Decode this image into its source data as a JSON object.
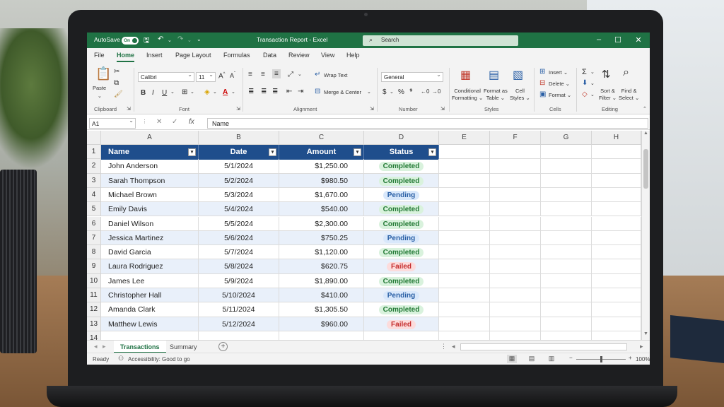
{
  "window": {
    "autosave_label": "AutoSave",
    "autosave_state": "On",
    "title": "Transaction Report - Excel",
    "search_placeholder": "Search"
  },
  "menu": [
    "File",
    "Home",
    "Insert",
    "Page Layout",
    "Formulas",
    "Data",
    "Review",
    "View",
    "Help"
  ],
  "ribbon": {
    "clipboard": {
      "paste": "Paste",
      "label": "Clipboard"
    },
    "font": {
      "name": "Calibri",
      "size": "11",
      "label": "Font"
    },
    "alignment": {
      "wrap_text": "Wrap Text",
      "merge_center": "Merge & Center",
      "label": "Alignment"
    },
    "number": {
      "format": "General",
      "label": "Number"
    },
    "styles": {
      "conditional": "Conditional",
      "formatting": "Formatting",
      "format_as": "Format as",
      "table": "Table",
      "cell": "Cell",
      "cell_styles": "Styles",
      "label": "Styles"
    },
    "cells": {
      "insert": "Insert",
      "delete": "Delete",
      "format": "Format",
      "label": "Cells"
    },
    "editing": {
      "sort": "Sort &",
      "filter": "Filter",
      "find": "Find &",
      "select": "Select",
      "label": "Editing"
    }
  },
  "formula_bar": {
    "cell_ref": "A1",
    "fx": "fx",
    "content": "Name"
  },
  "sheet": {
    "columns": [
      "A",
      "B",
      "C",
      "D",
      "E",
      "F",
      "G",
      "H"
    ],
    "headers": [
      "Name",
      "Date",
      "Amount",
      "Status"
    ],
    "row_numbers": [
      "1",
      "2",
      "3",
      "4",
      "5",
      "6",
      "7",
      "8",
      "9",
      "10",
      "11",
      "12",
      "13",
      "14"
    ],
    "rows": [
      {
        "name": "John Anderson",
        "date": "5/1/2024",
        "amount": "$1,250.00",
        "status": "Completed"
      },
      {
        "name": "Sarah Thompson",
        "date": "5/2/2024",
        "amount": "$980.50",
        "status": "Completed"
      },
      {
        "name": "Michael Brown",
        "date": "5/3/2024",
        "amount": "$1,670.00",
        "status": "Pending"
      },
      {
        "name": "Emily Davis",
        "date": "5/4/2024",
        "amount": "$540.00",
        "status": "Completed"
      },
      {
        "name": "Daniel Wilson",
        "date": "5/5/2024",
        "amount": "$2,300.00",
        "status": "Completed"
      },
      {
        "name": "Jessica Martinez",
        "date": "5/6/2024",
        "amount": "$750.25",
        "status": "Pending"
      },
      {
        "name": "David Garcia",
        "date": "5/7/2024",
        "amount": "$1,120.00",
        "status": "Completed"
      },
      {
        "name": "Laura Rodriguez",
        "date": "5/8/2024",
        "amount": "$620.75",
        "status": "Failed"
      },
      {
        "name": "James Lee",
        "date": "5/9/2024",
        "amount": "$1,890.00",
        "status": "Completed"
      },
      {
        "name": "Christopher Hall",
        "date": "5/10/2024",
        "amount": "$410.00",
        "status": "Pending"
      },
      {
        "name": "Amanda Clark",
        "date": "5/11/2024",
        "amount": "$1,305.50",
        "status": "Completed"
      },
      {
        "name": "Matthew Lewis",
        "date": "5/12/2024",
        "amount": "$960.00",
        "status": "Failed"
      }
    ]
  },
  "sheet_tabs": [
    "Transactions",
    "Summary"
  ],
  "status_bar": {
    "ready": "Ready",
    "accessibility": "Accessibility: Good to go",
    "zoom": "100%"
  },
  "colors": {
    "title_bar": "#1f7244",
    "table_header": "#1f4e8c",
    "completed": "#237a35",
    "pending": "#2a5fa5",
    "failed": "#c42b2b"
  }
}
